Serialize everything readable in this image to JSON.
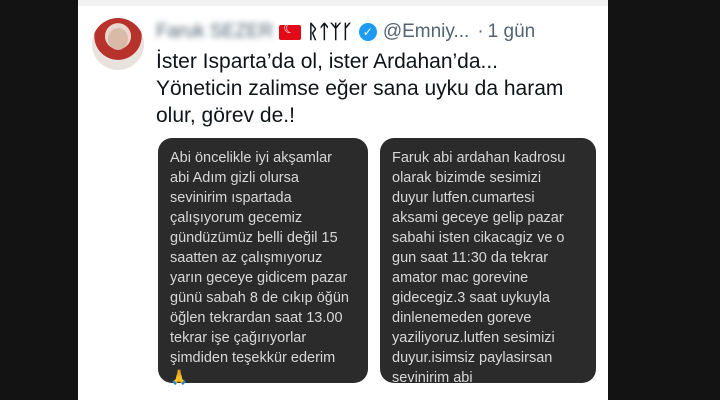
{
  "tweet": {
    "author_name": "Faruk SEZER",
    "runic_name": "ᚱᛏᛉᚴ",
    "handle": "@Emniy...",
    "separator": "·",
    "time": "1 gün",
    "text_lines": [
      "İster Isparta’da ol, ister Ardahan’da...",
      "Yöneticin zalimse eğer sana uyku da haram",
      "olur, görev de.!"
    ]
  },
  "message_left": {
    "lines": [
      "Abi öncelikle iyi akşamlar",
      "abi Adım gizli olursa",
      "sevinirim ıspartada",
      "çalışıyorum gecemiz",
      "gündüzümüz belli değil 15",
      "saatten az çalışmıyoruz",
      "yarın geceye gidicem pazar",
      "günü sabah 8 de cıkıp öğün",
      "öğlen tekrardan saat 13.00",
      "tekrar işe çağırıyorlar",
      "şimdiden teşekkür ederim"
    ],
    "emoji": "🙏"
  },
  "message_right": {
    "lines": [
      "Faruk abi ardahan kadrosu",
      "olarak bizimde sesimizi",
      "duyur lutfen.cumartesi",
      "aksami geceye gelip  pazar",
      "sabahi isten  cikacagiz ve o",
      "gun saat 11:30 da tekrar",
      "amator mac gorevine",
      "gidecegiz.3 saat uykuyla",
      "dinlenemeden goreve",
      "yaziliyoruz.lutfen sesimizi",
      "duyur.isimsiz paylasirsan",
      "sevinirim abi"
    ]
  }
}
